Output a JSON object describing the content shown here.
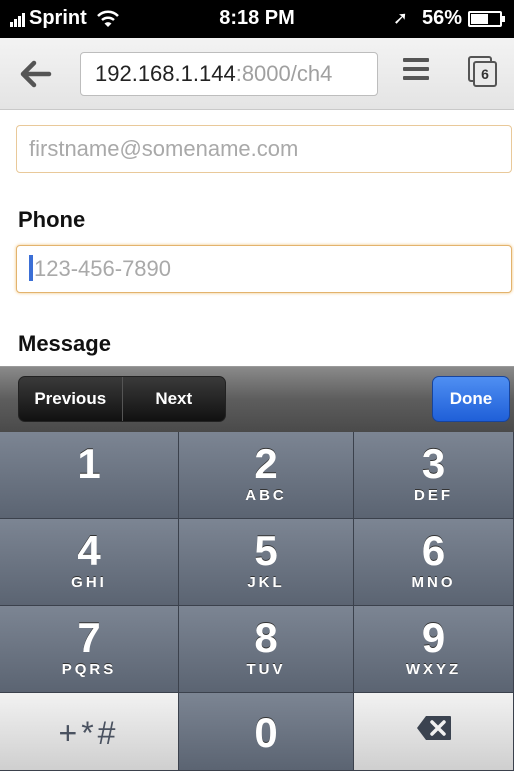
{
  "status_bar": {
    "carrier": "Sprint",
    "time": "8:18 PM",
    "battery": "56%"
  },
  "browser": {
    "url_host": "192.168.1.144",
    "url_rest": ":8000/ch4",
    "tab_count": "6"
  },
  "form": {
    "email_placeholder": "firstname@somename.com",
    "phone_label": "Phone",
    "phone_placeholder": "123-456-7890",
    "message_label": "Message"
  },
  "accessory": {
    "previous_label": "Previous",
    "next_label": "Next",
    "done_label": "Done"
  },
  "keypad": {
    "keys": [
      {
        "num": "1",
        "letters": ""
      },
      {
        "num": "2",
        "letters": "ABC"
      },
      {
        "num": "3",
        "letters": "DEF"
      },
      {
        "num": "4",
        "letters": "GHI"
      },
      {
        "num": "5",
        "letters": "JKL"
      },
      {
        "num": "6",
        "letters": "MNO"
      },
      {
        "num": "7",
        "letters": "PQRS"
      },
      {
        "num": "8",
        "letters": "TUV"
      },
      {
        "num": "9",
        "letters": "WXYZ"
      }
    ],
    "symbols": "+*#",
    "zero": "0"
  },
  "colors": {
    "accent_done": "#2c6be0",
    "field_focus": "#e3b36d",
    "caret": "#3b6fd6"
  }
}
